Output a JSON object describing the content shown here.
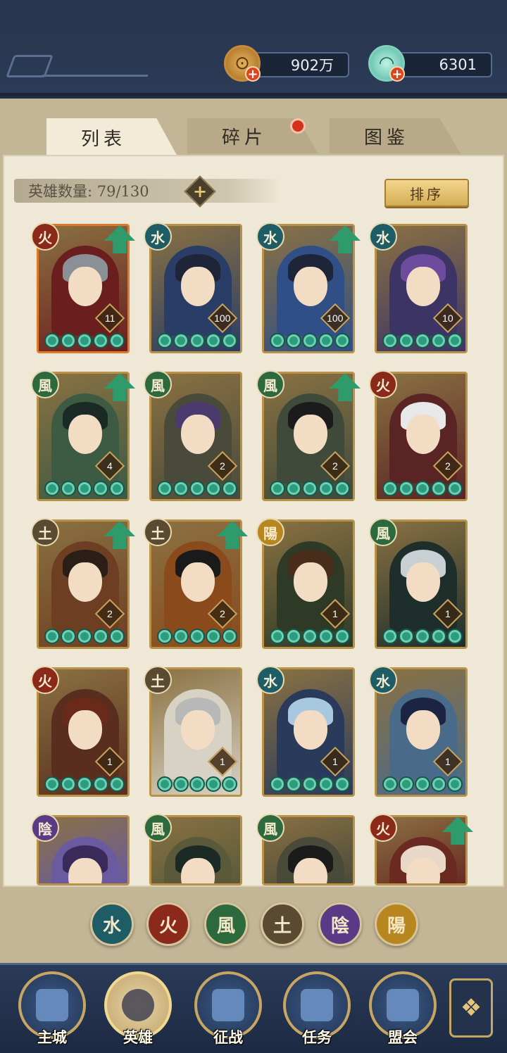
{
  "resources": {
    "coins": "902万",
    "shells": "6301"
  },
  "tabs": [
    {
      "label": "列表"
    },
    {
      "label": "碎片"
    },
    {
      "label": "图鉴"
    }
  ],
  "hero_count": "英雄数量: 79/130",
  "sort_label": "排序",
  "elements": {
    "fire": "火",
    "water": "水",
    "wind": "風",
    "earth": "土",
    "yin": "陰",
    "yang": "陽"
  },
  "heroes": [
    {
      "element": "火",
      "level": "11",
      "stars": 5,
      "upgrade": true,
      "hair": "#8b8f96",
      "bg": "#6b1e1e"
    },
    {
      "element": "水",
      "level": "100",
      "stars": 5,
      "upgrade": false,
      "hair": "#1e2538",
      "bg": "#2a3d66"
    },
    {
      "element": "水",
      "level": "100",
      "stars": 5,
      "upgrade": true,
      "hair": "#1e2538",
      "bg": "#2f4f86"
    },
    {
      "element": "水",
      "level": "10",
      "stars": 5,
      "upgrade": false,
      "hair": "#6d4b9d",
      "bg": "#3d3466"
    },
    {
      "element": "風",
      "level": "4",
      "stars": 5,
      "upgrade": true,
      "hair": "#1b2a24",
      "bg": "#3d5a42"
    },
    {
      "element": "風",
      "level": "2",
      "stars": 5,
      "upgrade": false,
      "hair": "#4b3a6e",
      "bg": "#4a4a3a"
    },
    {
      "element": "風",
      "level": "2",
      "stars": 5,
      "upgrade": true,
      "hair": "#1b1b1b",
      "bg": "#3f4a3a"
    },
    {
      "element": "火",
      "level": "2",
      "stars": 5,
      "upgrade": false,
      "hair": "#e8e8e8",
      "bg": "#5a2424"
    },
    {
      "element": "土",
      "level": "2",
      "stars": 5,
      "upgrade": true,
      "hair": "#2a1e16",
      "bg": "#6e3e22"
    },
    {
      "element": "土",
      "level": "2",
      "stars": 5,
      "upgrade": true,
      "hair": "#1a1a1a",
      "bg": "#8a4a1c"
    },
    {
      "element": "陽",
      "level": "1",
      "stars": 5,
      "upgrade": false,
      "hair": "#4a2c1a",
      "bg": "#2e3a26"
    },
    {
      "element": "風",
      "level": "1",
      "stars": 5,
      "upgrade": false,
      "hair": "#c8d0d4",
      "bg": "#1e2e2a"
    },
    {
      "element": "火",
      "level": "1",
      "stars": 5,
      "upgrade": false,
      "hair": "#6a2a1a",
      "bg": "#5a2e1e"
    },
    {
      "element": "土",
      "level": "1",
      "stars": 5,
      "upgrade": false,
      "hair": "#b8b8b8",
      "bg": "#d8d2c4"
    },
    {
      "element": "水",
      "level": "1",
      "stars": 5,
      "upgrade": false,
      "hair": "#a8c8e0",
      "bg": "#2a3a5a"
    },
    {
      "element": "水",
      "level": "1",
      "stars": 5,
      "upgrade": false,
      "hair": "#1c2444",
      "bg": "#4a6a8a"
    },
    {
      "element": "陰",
      "level": "",
      "stars": 0,
      "upgrade": false,
      "hair": "#3a2a5a",
      "bg": "#6a5aa0"
    },
    {
      "element": "風",
      "level": "",
      "stars": 0,
      "upgrade": false,
      "hair": "#1b2a24",
      "bg": "#5a5a3a"
    },
    {
      "element": "風",
      "level": "",
      "stars": 0,
      "upgrade": false,
      "hair": "#1b1b1b",
      "bg": "#4a4a3a"
    },
    {
      "element": "火",
      "level": "",
      "stars": 0,
      "upgrade": true,
      "hair": "#e8d8c8",
      "bg": "#6a2a22"
    }
  ],
  "filters": [
    "水",
    "火",
    "風",
    "土",
    "陰",
    "陽"
  ],
  "nav": [
    {
      "label": "主城",
      "icon": "city-gate-icon"
    },
    {
      "label": "英雄",
      "icon": "hero-portrait-icon"
    },
    {
      "label": "征战",
      "icon": "war-drum-icon"
    },
    {
      "label": "任务",
      "icon": "task-scroll-icon"
    },
    {
      "label": "盟会",
      "icon": "alliance-pavilion-icon"
    }
  ],
  "colors": {
    "accent_gold": "#c7a664",
    "upgrade_green": "#2f9a6c",
    "alert_red": "#d4311d"
  }
}
